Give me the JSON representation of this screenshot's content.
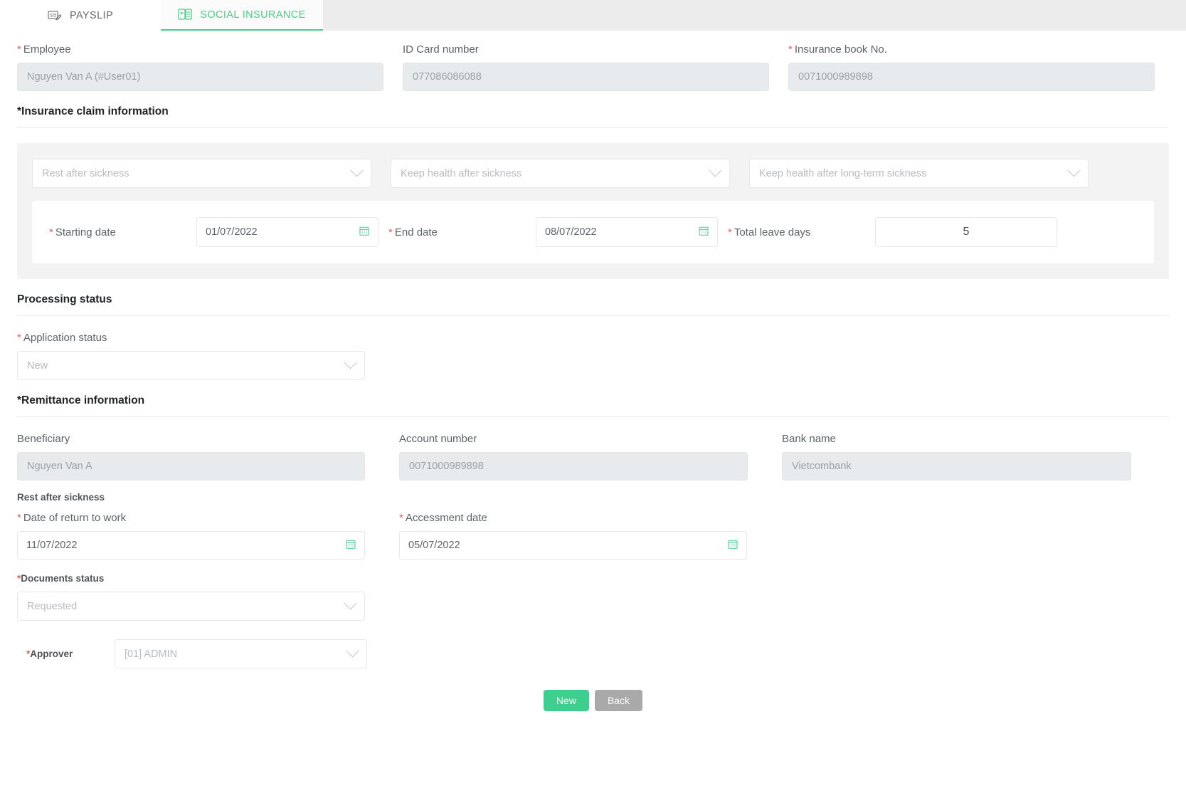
{
  "tabs": [
    {
      "label": "PAYSLIP",
      "icon": "payslip-icon",
      "active": false
    },
    {
      "label": "SOCIAL INSURANCE",
      "icon": "social-insurance-icon",
      "active": true
    }
  ],
  "colors": {
    "accent": "#44d08a",
    "required": "#e8615a",
    "button_primary": "#3ecf8e",
    "button_secondary": "#a9a9a9",
    "readonly_field": "#e7ebed"
  },
  "top_fields": {
    "employee": {
      "label": "Employee",
      "required": true,
      "value": "Nguyen Van A (#User01)"
    },
    "id_card": {
      "label": "ID Card number",
      "required": false,
      "value": "077086086088"
    },
    "insurance_book": {
      "label": "Insurance book No.",
      "required": true,
      "value": "0071000989898"
    }
  },
  "claim_section": {
    "heading": "*Insurance claim information",
    "selects": [
      {
        "name": "rest-after-sickness-select",
        "value": "Rest after sickness"
      },
      {
        "name": "keep-health-after-sickness-select",
        "value": "Keep health after sickness"
      },
      {
        "name": "keep-health-long-term-select",
        "value": "Keep health after long-term sickness"
      }
    ],
    "dates": {
      "starting_date": {
        "label": "Starting date",
        "required": true,
        "value": "01/07/2022"
      },
      "end_date": {
        "label": "End date",
        "required": true,
        "value": "08/07/2022"
      },
      "total_leave_days": {
        "label": "Total leave days",
        "required": true,
        "value": "5"
      }
    }
  },
  "processing": {
    "heading": "Processing status",
    "application_status": {
      "label": "Application status",
      "required": true,
      "value": "New"
    }
  },
  "remittance": {
    "heading": "*Remittance information",
    "beneficiary": {
      "label": "Beneficiary",
      "value": "Nguyen Van A"
    },
    "account_number": {
      "label": "Account number",
      "value": "0071000989898"
    },
    "bank_name": {
      "label": "Bank name",
      "value": "Vietcombank"
    },
    "subheading": "Rest after sickness",
    "return_date": {
      "label": "Date of return to work",
      "required": true,
      "value": "11/07/2022"
    },
    "accessment_date": {
      "label": "Accessment date",
      "required": true,
      "value": "05/07/2022"
    },
    "documents_status": {
      "label": "*Documents status",
      "value": "Requested"
    },
    "approver": {
      "label": "*Approver",
      "value": "[01] ADMIN"
    }
  },
  "buttons": {
    "new": "New",
    "back": "Back"
  }
}
